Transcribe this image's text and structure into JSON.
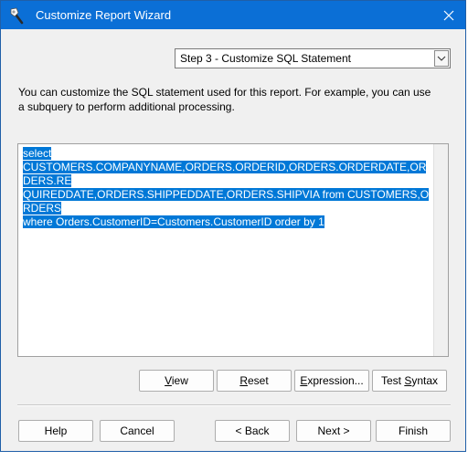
{
  "window": {
    "title": "Customize Report Wizard",
    "accent_color": "#0b6fd6",
    "title_icon": "wizard-wand-icon",
    "close_icon": "close-icon"
  },
  "step_select": {
    "value": "Step 3 - Customize SQL Statement",
    "arrow_icon": "chevron-down-icon"
  },
  "description": "You can customize the SQL statement used for this report. For example, you can use a subquery to perform additional processing.",
  "sql": {
    "line1": "select",
    "line2": "CUSTOMERS.COMPANYNAME,ORDERS.ORDERID,ORDERS.ORDERDATE,ORDERS.RE",
    "line3": "QUIREDDATE,ORDERS.SHIPPEDDATE,ORDERS.SHIPVIA from CUSTOMERS,ORDERS",
    "line4": "where Orders.CustomerID=Customers.CustomerID order by 1",
    "selection_color": "#0078d7"
  },
  "buttons": {
    "view": {
      "first": "V",
      "rest": "iew"
    },
    "reset": {
      "first": "R",
      "rest": "eset"
    },
    "expression": {
      "first": "E",
      "rest": "xpression..."
    },
    "test_syntax": {
      "pre": "Test ",
      "mid": "S",
      "rest": "yntax"
    }
  },
  "footer": {
    "help": "Help",
    "cancel": "Cancel",
    "back": "< Back",
    "next": "Next >",
    "finish": "Finish"
  }
}
